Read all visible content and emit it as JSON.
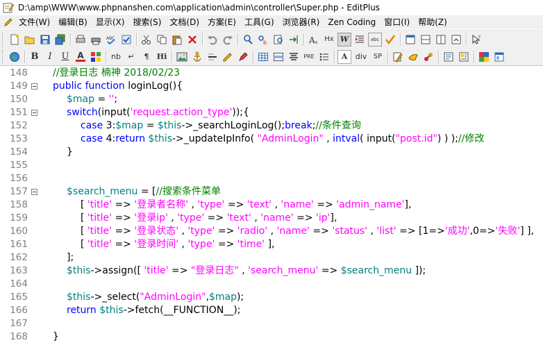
{
  "window": {
    "title": "D:\\amp\\WWW\\www.phpnanshen.com\\application\\admin\\controller\\Super.php - EditPlus"
  },
  "menu": [
    "文件(W)",
    "编辑(B)",
    "显示(X)",
    "搜索(S)",
    "文档(D)",
    "方案(E)",
    "工具(G)",
    "浏览器(R)",
    "Zen Coding",
    "窗口(I)",
    "帮助(Z)"
  ],
  "toolbar1_icons": [
    "new-file-icon",
    "open-folder-icon",
    "save-icon",
    "save-all-icon",
    "sep",
    "print-preview-icon",
    "print-icon",
    "spell-check-icon",
    "check-icon",
    "sep",
    "cut-icon",
    "copy-icon",
    "paste-icon",
    "delete-icon",
    "sep",
    "undo-icon",
    "redo-icon",
    "sep",
    "find-icon",
    "replace-icon",
    "find-in-files-icon",
    "goto-line-icon",
    "sep",
    "font-icon",
    "hex-icon",
    "word-wrap-icon",
    "indent-icon",
    "column-select-icon",
    "spell-icon",
    "sep",
    "view-1-icon",
    "view-2-icon",
    "view-3-icon",
    "view-4-icon",
    "sep",
    "help-cursor-icon"
  ],
  "toolbar2_icons": [
    "browser-globe-icon",
    "sep",
    "bold-icon",
    "italic-icon",
    "underline-icon",
    "font-color-icon",
    "highlight-icon",
    "sep",
    "nbsp-icon",
    "br-icon",
    "paragraph-icon",
    "heading-icon",
    "sep",
    "image-icon",
    "anchor-icon",
    "hr-icon",
    "comment-icon",
    "pen-icon",
    "sep",
    "table-icon",
    "table-row-icon",
    "center-icon",
    "pre-icon",
    "list-icon",
    "sep",
    "font-tag-icon",
    "div-icon",
    "span-icon",
    "sep",
    "form-edit-icon",
    "clear-icon",
    "tools-icon",
    "sep",
    "preview-1-icon",
    "preview-2-icon",
    "sep",
    "color-picker-icon",
    "window-icon"
  ],
  "toolbar2_text": {
    "bold": "B",
    "italic": "I",
    "underline": "U",
    "fontcolor": "A",
    "nb": "nb",
    "br": "↵",
    "para": "¶",
    "hi": "Hi",
    "pre": "PRE",
    "font": "A",
    "div": "div",
    "sp": "SP",
    "hx": "Hx",
    "w": "W",
    "abc": "abc"
  },
  "editor": {
    "lines": [
      {
        "n": "148",
        "fold": false,
        "segs": [
          [
            "i",
            "        "
          ],
          [
            "cmt",
            "//登录日志 楠神 2018/02/23"
          ]
        ]
      },
      {
        "n": "149",
        "fold": true,
        "segs": [
          [
            "i",
            "        "
          ],
          [
            "kw",
            "public function "
          ],
          [
            "pl",
            "loginLog(){"
          ]
        ]
      },
      {
        "n": "150",
        "fold": false,
        "segs": [
          [
            "i",
            "            "
          ],
          [
            "var",
            "$map"
          ],
          [
            "pl",
            " = "
          ],
          [
            "str",
            "''"
          ],
          [
            "pl",
            ";"
          ]
        ]
      },
      {
        "n": "151",
        "fold": true,
        "segs": [
          [
            "i",
            "            "
          ],
          [
            "kw",
            "switch"
          ],
          [
            "pl",
            "(input("
          ],
          [
            "str",
            "'request.action_type'"
          ],
          [
            "pl",
            "));{"
          ]
        ]
      },
      {
        "n": "152",
        "fold": false,
        "segs": [
          [
            "i",
            "                "
          ],
          [
            "kw",
            "case "
          ],
          [
            "pl",
            "3:"
          ],
          [
            "var",
            "$map"
          ],
          [
            "pl",
            " = "
          ],
          [
            "var",
            "$this"
          ],
          [
            "pl",
            "->_searchLoginLog();"
          ],
          [
            "kw",
            "break"
          ],
          [
            "pl",
            ";"
          ],
          [
            "cmt",
            "//条件查询"
          ]
        ]
      },
      {
        "n": "153",
        "fold": false,
        "segs": [
          [
            "i",
            "                "
          ],
          [
            "kw",
            "case "
          ],
          [
            "pl",
            "4:"
          ],
          [
            "kw",
            "return "
          ],
          [
            "var",
            "$this"
          ],
          [
            "pl",
            "->_updateIpInfo( "
          ],
          [
            "str",
            "\"AdminLogin\""
          ],
          [
            "pl",
            " , "
          ],
          [
            "kw",
            "intval"
          ],
          [
            "pl",
            "( input("
          ],
          [
            "str",
            "\"post.id\""
          ],
          [
            "pl",
            ") ) );"
          ],
          [
            "cmt",
            "//修改"
          ]
        ]
      },
      {
        "n": "154",
        "fold": false,
        "segs": [
          [
            "i",
            "            "
          ],
          [
            "pl",
            "}"
          ]
        ]
      },
      {
        "n": "155",
        "fold": false,
        "segs": []
      },
      {
        "n": "156",
        "fold": false,
        "segs": []
      },
      {
        "n": "157",
        "fold": true,
        "segs": [
          [
            "i",
            "            "
          ],
          [
            "var",
            "$search_menu"
          ],
          [
            "pl",
            " = ["
          ],
          [
            "cmt",
            "//搜索条件菜单"
          ]
        ]
      },
      {
        "n": "158",
        "fold": false,
        "segs": [
          [
            "i",
            "                "
          ],
          [
            "pl",
            "[ "
          ],
          [
            "str",
            "'title'"
          ],
          [
            "pl",
            " => "
          ],
          [
            "str",
            "'登录者名称'"
          ],
          [
            "pl",
            " , "
          ],
          [
            "str",
            "'type'"
          ],
          [
            "pl",
            " => "
          ],
          [
            "str",
            "'text'"
          ],
          [
            "pl",
            " , "
          ],
          [
            "str",
            "'name'"
          ],
          [
            "pl",
            " => "
          ],
          [
            "str",
            "'admin_name'"
          ],
          [
            "pl",
            "],"
          ]
        ]
      },
      {
        "n": "159",
        "fold": false,
        "segs": [
          [
            "i",
            "                "
          ],
          [
            "pl",
            "[ "
          ],
          [
            "str",
            "'title'"
          ],
          [
            "pl",
            " => "
          ],
          [
            "str",
            "'登录ip'"
          ],
          [
            "pl",
            " , "
          ],
          [
            "str",
            "'type'"
          ],
          [
            "pl",
            " => "
          ],
          [
            "str",
            "'text'"
          ],
          [
            "pl",
            " , "
          ],
          [
            "str",
            "'name'"
          ],
          [
            "pl",
            " => "
          ],
          [
            "str",
            "'ip'"
          ],
          [
            "pl",
            "],"
          ]
        ]
      },
      {
        "n": "160",
        "fold": false,
        "segs": [
          [
            "i",
            "                "
          ],
          [
            "pl",
            "[ "
          ],
          [
            "str",
            "'title'"
          ],
          [
            "pl",
            " => "
          ],
          [
            "str",
            "'登录状态'"
          ],
          [
            "pl",
            " , "
          ],
          [
            "str",
            "'type'"
          ],
          [
            "pl",
            " => "
          ],
          [
            "str",
            "'radio'"
          ],
          [
            "pl",
            " , "
          ],
          [
            "str",
            "'name'"
          ],
          [
            "pl",
            " => "
          ],
          [
            "str",
            "'status'"
          ],
          [
            "pl",
            " , "
          ],
          [
            "str",
            "'list'"
          ],
          [
            "pl",
            " => [1=>"
          ],
          [
            "str",
            "'成功'"
          ],
          [
            "pl",
            ",0=>"
          ],
          [
            "str",
            "'失败'"
          ],
          [
            "pl",
            "] ],"
          ]
        ]
      },
      {
        "n": "161",
        "fold": false,
        "segs": [
          [
            "i",
            "                "
          ],
          [
            "pl",
            "[ "
          ],
          [
            "str",
            "'title'"
          ],
          [
            "pl",
            " => "
          ],
          [
            "str",
            "'登录时间'"
          ],
          [
            "pl",
            " , "
          ],
          [
            "str",
            "'type'"
          ],
          [
            "pl",
            " => "
          ],
          [
            "str",
            "'time'"
          ],
          [
            "pl",
            " ],"
          ]
        ]
      },
      {
        "n": "162",
        "fold": false,
        "segs": [
          [
            "i",
            "            "
          ],
          [
            "pl",
            "];"
          ]
        ]
      },
      {
        "n": "163",
        "fold": false,
        "segs": [
          [
            "i",
            "            "
          ],
          [
            "var",
            "$this"
          ],
          [
            "pl",
            "->assign([ "
          ],
          [
            "str",
            "'title'"
          ],
          [
            "pl",
            " => "
          ],
          [
            "str",
            "\"登录日志\""
          ],
          [
            "pl",
            " , "
          ],
          [
            "str",
            "'search_menu'"
          ],
          [
            "pl",
            " => "
          ],
          [
            "var",
            "$search_menu"
          ],
          [
            "pl",
            " ]);"
          ]
        ]
      },
      {
        "n": "164",
        "fold": false,
        "segs": []
      },
      {
        "n": "165",
        "fold": false,
        "segs": [
          [
            "i",
            "            "
          ],
          [
            "var",
            "$this"
          ],
          [
            "pl",
            "->_select("
          ],
          [
            "str",
            "\"AdminLogin\""
          ],
          [
            "pl",
            ","
          ],
          [
            "var",
            "$map"
          ],
          [
            "pl",
            ");"
          ]
        ]
      },
      {
        "n": "166",
        "fold": false,
        "segs": [
          [
            "i",
            "            "
          ],
          [
            "kw",
            "return "
          ],
          [
            "var",
            "$this"
          ],
          [
            "pl",
            "->fetch(__FUNCTION__);"
          ]
        ]
      },
      {
        "n": "167",
        "fold": false,
        "segs": []
      },
      {
        "n": "168",
        "fold": false,
        "segs": [
          [
            "i",
            "        "
          ],
          [
            "pl",
            "}"
          ]
        ]
      }
    ]
  }
}
